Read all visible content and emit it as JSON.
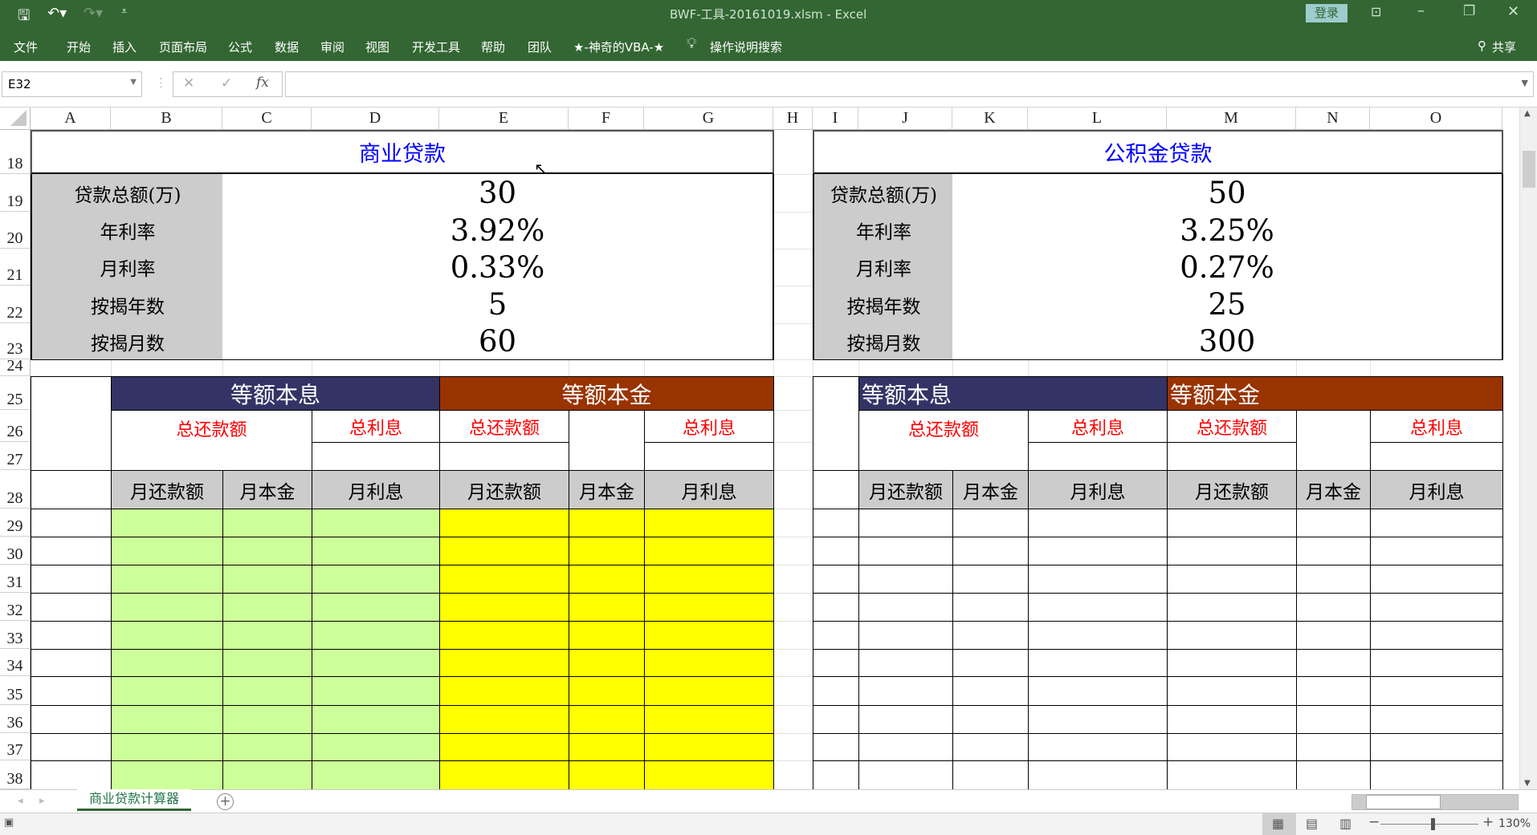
{
  "titlebar": {
    "title": "BWF-工具-20161019.xlsm  -  Excel",
    "login": "登录"
  },
  "ribbon": {
    "tabs": [
      "文件",
      "开始",
      "插入",
      "页面布局",
      "公式",
      "数据",
      "审阅",
      "视图",
      "开发工具",
      "帮助",
      "团队",
      "★-神奇的VBA-★"
    ],
    "search": "操作说明搜索",
    "share": "共享"
  },
  "formula_bar": {
    "name_box": "E32",
    "formula": ""
  },
  "columns": [
    "A",
    "B",
    "C",
    "D",
    "E",
    "F",
    "G",
    "H",
    "I",
    "J",
    "K",
    "L",
    "M",
    "N",
    "O"
  ],
  "rows": [
    "18",
    "19",
    "20",
    "21",
    "22",
    "23",
    "24",
    "25",
    "26",
    "27",
    "28",
    "29",
    "30",
    "31",
    "32",
    "33",
    "34",
    "35",
    "36",
    "37",
    "38"
  ],
  "left": {
    "title": "商业贷款",
    "labels": [
      "贷款总额(万)",
      "年利率",
      "月利率",
      "按揭年数",
      "按揭月数"
    ],
    "values": [
      "30",
      "3.92%",
      "0.33%",
      "5",
      "60"
    ],
    "method1": "等额本息",
    "method2": "等额本金",
    "total_payment": "总还款额",
    "total_interest": "总利息",
    "cols": [
      "月还款额",
      "月本金",
      "月利息",
      "月还款额",
      "月本金",
      "月利息"
    ]
  },
  "right": {
    "title": "公积金贷款",
    "labels": [
      "贷款总额(万)",
      "年利率",
      "月利率",
      "按揭年数",
      "按揭月数"
    ],
    "values": [
      "50",
      "3.25%",
      "0.27%",
      "25",
      "300"
    ],
    "method1": "等额本息",
    "method2": "等额本金",
    "total_payment": "总还款额",
    "total_interest": "总利息",
    "cols": [
      "月还款额",
      "月本金",
      "月利息",
      "月还款额",
      "月本金",
      "月利息"
    ]
  },
  "sheet_tabs": [
    "商业贷款计算器"
  ],
  "status": {
    "zoom": "130%"
  },
  "colors": {
    "excel_green": "#336633",
    "navy": "#333366",
    "brown": "#993300",
    "green_fill": "#ccff99",
    "yellow_fill": "#ffff00",
    "label_gray": "#cccccc",
    "title_blue": "#0000ff",
    "red": "#ff0000"
  }
}
